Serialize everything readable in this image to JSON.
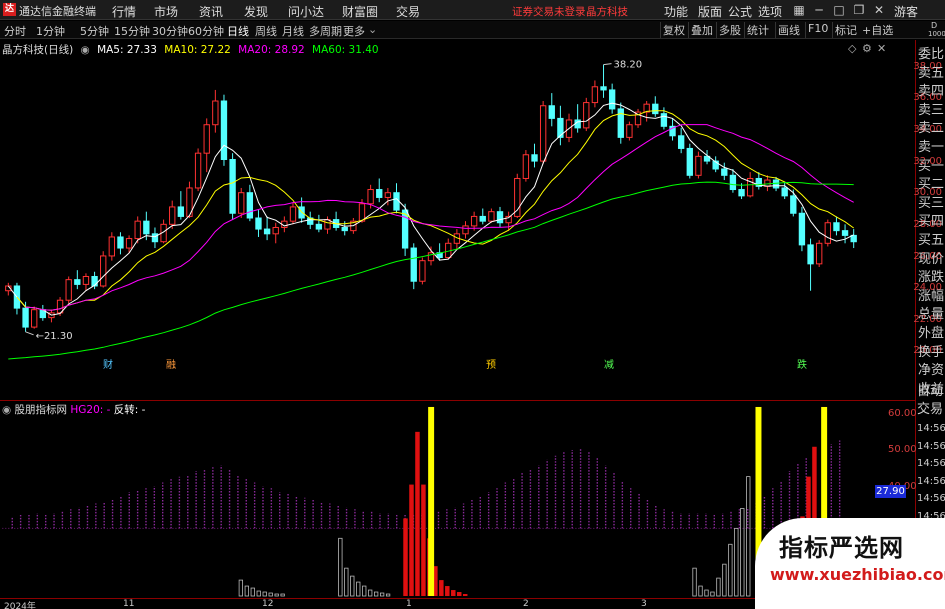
{
  "app": {
    "title": "通达信金融终端",
    "logo": "达",
    "menus": [
      "行情",
      "市场",
      "资讯",
      "发现",
      "问小达",
      "财富圈",
      "交易"
    ],
    "notice1": "证券交易未登录",
    "notice2": "晶方科技",
    "right_menus": [
      "功能",
      "版面",
      "公式",
      "选项"
    ],
    "guest": "游客"
  },
  "period_tabs": [
    "分时",
    "1分钟",
    "5分钟",
    "15分钟",
    "30分钟",
    "60分钟",
    "日线",
    "周线",
    "月线",
    "多周期",
    "更多"
  ],
  "active_tab": "日线",
  "tools": [
    "复权",
    "叠加",
    "多股",
    "统计",
    "画线",
    "F10",
    "标记"
  ],
  "add_fav": "+自选",
  "stock_title": "晶方科技(日线)",
  "ma": {
    "ma5": "MA5: 27.33",
    "ma10": "MA10: 27.22",
    "ma20": "MA20: 28.92",
    "ma60": "MA60: 31.40"
  },
  "side_panel": [
    "委比",
    "卖五",
    "卖四",
    "卖三",
    "卖二",
    "卖一",
    "买一",
    "买二",
    "买三",
    "买四",
    "买五",
    "现价",
    "涨跌",
    "涨幅",
    "总量",
    "外盘",
    "换手",
    "净资",
    "收益"
  ],
  "side_top": [
    "D",
    "1000"
  ],
  "indicator": {
    "name": "股朋指标网",
    "hg": "HG20: -",
    "fanzhuan": "反转: -",
    "side": [
      "自动",
      "交易"
    ],
    "value_box": "27.90"
  },
  "price_markers": {
    "high": "38.20",
    "low": "21.30"
  },
  "event_marks": [
    "财",
    "融",
    "预",
    "减",
    "跌"
  ],
  "date_axis": [
    "2024年",
    "11",
    "12",
    "1",
    "2",
    "3"
  ],
  "times": [
    "14:56",
    "14:56",
    "14:56",
    "14:56",
    "14:56",
    "14:56",
    "14:56",
    "14:56",
    "14:56"
  ],
  "watermark": {
    "main": "指标严选网",
    "sub": "www.xuezhibiao.com"
  },
  "colors": {
    "up": "#ff3232",
    "down": "#54ffff",
    "ma5": "#ffffff",
    "ma10": "#ffff00",
    "ma20": "#ff00ff",
    "ma60": "#00ff00",
    "axis": "#d23c3c"
  },
  "chart_data": [
    {
      "type": "candlestick",
      "ylim": [
        18,
        39
      ],
      "yticks": [
        20.0,
        22.0,
        24.0,
        26.0,
        28.0,
        30.0,
        32.0,
        34.0,
        36.0,
        38.0
      ],
      "ohlc": [
        [
          23.9,
          24.4,
          23.6,
          24.2
        ],
        [
          24.2,
          24.4,
          22.4,
          22.8
        ],
        [
          22.8,
          23.2,
          21.3,
          21.6
        ],
        [
          21.6,
          22.9,
          21.5,
          22.7
        ],
        [
          22.7,
          23.0,
          22.0,
          22.2
        ],
        [
          22.2,
          22.7,
          21.9,
          22.5
        ],
        [
          22.5,
          23.5,
          22.3,
          23.3
        ],
        [
          23.3,
          24.8,
          23.1,
          24.6
        ],
        [
          24.6,
          25.2,
          24.0,
          24.3
        ],
        [
          24.3,
          25.0,
          23.9,
          24.8
        ],
        [
          24.8,
          25.1,
          24.0,
          24.2
        ],
        [
          24.2,
          26.4,
          24.1,
          26.1
        ],
        [
          26.1,
          27.6,
          25.8,
          27.3
        ],
        [
          27.3,
          27.6,
          26.2,
          26.6
        ],
        [
          26.6,
          27.4,
          26.3,
          27.2
        ],
        [
          27.2,
          28.6,
          26.9,
          28.3
        ],
        [
          28.3,
          28.9,
          27.1,
          27.5
        ],
        [
          27.5,
          27.9,
          26.6,
          27.0
        ],
        [
          27.0,
          28.4,
          26.9,
          28.1
        ],
        [
          28.1,
          29.6,
          27.8,
          29.2
        ],
        [
          29.2,
          30.2,
          28.4,
          28.6
        ],
        [
          28.6,
          30.8,
          28.5,
          30.4
        ],
        [
          30.4,
          32.9,
          30.2,
          32.6
        ],
        [
          32.6,
          34.8,
          31.4,
          34.4
        ],
        [
          34.4,
          36.6,
          33.9,
          35.9
        ],
        [
          35.9,
          36.3,
          31.8,
          32.2
        ],
        [
          32.2,
          32.6,
          28.4,
          28.8
        ],
        [
          28.8,
          30.4,
          28.5,
          30.1
        ],
        [
          30.1,
          30.6,
          28.3,
          28.5
        ],
        [
          28.5,
          29.0,
          27.3,
          27.8
        ],
        [
          27.8,
          28.6,
          27.1,
          27.5
        ],
        [
          27.5,
          28.2,
          26.9,
          27.9
        ],
        [
          27.9,
          28.6,
          27.6,
          28.3
        ],
        [
          28.3,
          29.5,
          28.1,
          29.2
        ],
        [
          29.2,
          29.8,
          28.2,
          28.5
        ],
        [
          28.5,
          28.9,
          27.8,
          28.1
        ],
        [
          28.1,
          28.7,
          27.6,
          27.8
        ],
        [
          27.8,
          28.6,
          27.5,
          28.4
        ],
        [
          28.4,
          28.9,
          27.7,
          27.9
        ],
        [
          27.9,
          28.3,
          27.4,
          27.7
        ],
        [
          27.7,
          28.5,
          27.5,
          28.3
        ],
        [
          28.3,
          29.7,
          28.2,
          29.4
        ],
        [
          29.4,
          30.6,
          29.1,
          30.3
        ],
        [
          30.3,
          31.0,
          29.5,
          29.8
        ],
        [
          29.8,
          30.4,
          29.3,
          30.1
        ],
        [
          30.1,
          30.7,
          28.8,
          29.0
        ],
        [
          29.0,
          29.4,
          26.1,
          26.6
        ],
        [
          26.6,
          26.9,
          24.0,
          24.5
        ],
        [
          24.5,
          26.0,
          24.3,
          25.8
        ],
        [
          25.8,
          26.7,
          25.5,
          26.3
        ],
        [
          26.3,
          26.9,
          25.8,
          26.0
        ],
        [
          26.0,
          27.2,
          25.9,
          26.9
        ],
        [
          26.9,
          27.8,
          26.5,
          27.5
        ],
        [
          27.5,
          28.3,
          27.2,
          28.0
        ],
        [
          28.0,
          28.9,
          27.7,
          28.6
        ],
        [
          28.6,
          29.1,
          28.1,
          28.3
        ],
        [
          28.3,
          29.1,
          28.2,
          28.9
        ],
        [
          28.9,
          29.2,
          27.9,
          28.2
        ],
        [
          28.2,
          28.9,
          27.7,
          28.6
        ],
        [
          28.6,
          31.3,
          28.5,
          31.0
        ],
        [
          31.0,
          32.8,
          30.8,
          32.5
        ],
        [
          32.5,
          33.2,
          31.7,
          32.1
        ],
        [
          32.1,
          35.9,
          31.9,
          35.6
        ],
        [
          35.6,
          36.4,
          34.3,
          34.8
        ],
        [
          34.8,
          35.6,
          33.1,
          33.6
        ],
        [
          33.6,
          35.1,
          33.3,
          34.7
        ],
        [
          34.7,
          35.7,
          33.9,
          34.2
        ],
        [
          34.2,
          36.1,
          34.0,
          35.8
        ],
        [
          35.8,
          37.2,
          35.5,
          36.8
        ],
        [
          36.8,
          38.2,
          36.1,
          36.6
        ],
        [
          36.6,
          37.0,
          35.1,
          35.4
        ],
        [
          35.4,
          35.8,
          33.2,
          33.6
        ],
        [
          33.6,
          34.6,
          33.4,
          34.4
        ],
        [
          34.4,
          35.4,
          34.2,
          35.2
        ],
        [
          35.2,
          35.9,
          34.6,
          35.7
        ],
        [
          35.7,
          36.2,
          34.9,
          35.1
        ],
        [
          35.1,
          35.5,
          34.1,
          34.3
        ],
        [
          34.3,
          34.8,
          33.4,
          33.7
        ],
        [
          33.7,
          34.2,
          32.6,
          32.9
        ],
        [
          32.9,
          33.2,
          31.0,
          31.2
        ],
        [
          31.2,
          32.7,
          31.0,
          32.4
        ],
        [
          32.4,
          32.8,
          31.9,
          32.1
        ],
        [
          32.1,
          32.4,
          31.4,
          31.6
        ],
        [
          31.6,
          32.0,
          30.9,
          31.2
        ],
        [
          31.2,
          31.6,
          30.1,
          30.3
        ],
        [
          30.3,
          30.7,
          29.7,
          29.9
        ],
        [
          29.9,
          31.4,
          29.8,
          31.0
        ],
        [
          31.0,
          31.4,
          30.3,
          30.5
        ],
        [
          30.5,
          31.2,
          30.2,
          30.9
        ],
        [
          30.9,
          31.1,
          30.2,
          30.4
        ],
        [
          30.4,
          30.8,
          29.7,
          29.9
        ],
        [
          29.9,
          30.3,
          28.6,
          28.8
        ],
        [
          28.8,
          29.2,
          26.4,
          26.8
        ],
        [
          26.8,
          27.2,
          23.9,
          25.6
        ],
        [
          25.6,
          27.1,
          25.4,
          26.9
        ],
        [
          26.9,
          28.4,
          26.7,
          28.2
        ],
        [
          28.2,
          28.6,
          27.4,
          27.7
        ],
        [
          27.7,
          28.1,
          26.9,
          27.4
        ],
        [
          27.4,
          27.8,
          26.6,
          27.0
        ]
      ]
    },
    {
      "type": "bar",
      "ylim": [
        10,
        62
      ],
      "yticks": [
        20.0,
        30.0,
        40.0,
        50.0,
        60.0
      ],
      "series": [
        {
          "name": "HG20",
          "values": []
        },
        {
          "name": "反转",
          "values": []
        }
      ],
      "indicator_bars": [
        6,
        7,
        7,
        8,
        7,
        8,
        9,
        10,
        11,
        12,
        13,
        14,
        15,
        17,
        19,
        20,
        21,
        22,
        24,
        26,
        27,
        28,
        30,
        31,
        32,
        33,
        31,
        28,
        26,
        24,
        22,
        21,
        19,
        18,
        17,
        16,
        15,
        14,
        13,
        12,
        11,
        10,
        9,
        9,
        8,
        8,
        7,
        7,
        7,
        8,
        8,
        9,
        10,
        11,
        13,
        15,
        17,
        19,
        21,
        24,
        26,
        29,
        31,
        33,
        36,
        38,
        40,
        41,
        42,
        40,
        37,
        33,
        29,
        25,
        21,
        18,
        15,
        12,
        10,
        9,
        8,
        8,
        8,
        8,
        7,
        8,
        9,
        10,
        11,
        14,
        17,
        21,
        25,
        30,
        34,
        37,
        40,
        42,
        44,
        46
      ]
    }
  ]
}
